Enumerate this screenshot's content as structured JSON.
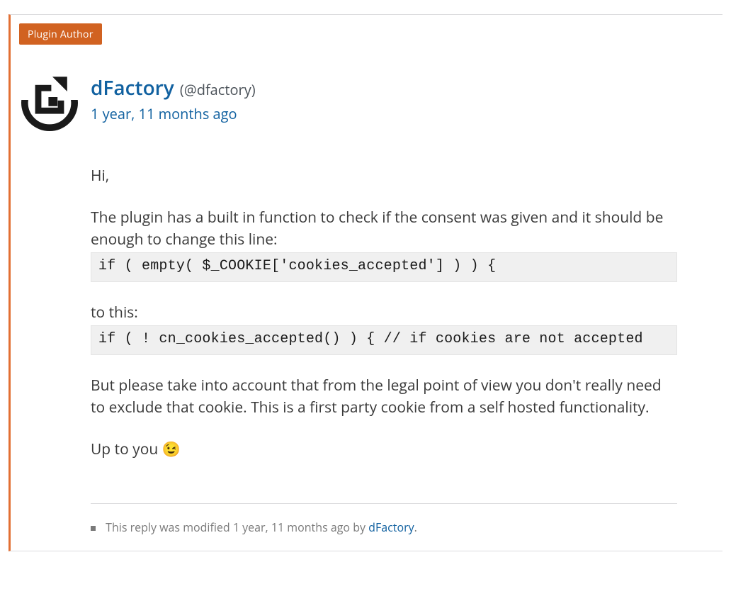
{
  "badge": "Plugin Author",
  "author": {
    "name": "dFactory",
    "handle": "(@dfactory)"
  },
  "timestamp": "1 year, 11 months ago",
  "content": {
    "greeting": "Hi,",
    "intro": "The plugin has a built in function to check if the consent was given and it should be enough to change this line:",
    "code1": "if ( empty( $_COOKIE['cookies_accepted'] ) ) {",
    "bridge": "to this:",
    "code2": "if ( ! cn_cookies_accepted() ) { // if cookies are not accepted",
    "legal": "But please take into account that from the legal point of view you don't really need to exclude that cookie. This is a first party cookie from a self hosted functionality.",
    "closing": "Up to you 😉"
  },
  "modlog": {
    "prefix": "This reply was modified 1 year, 11 months ago by ",
    "author": "dFactory",
    "suffix": "."
  }
}
